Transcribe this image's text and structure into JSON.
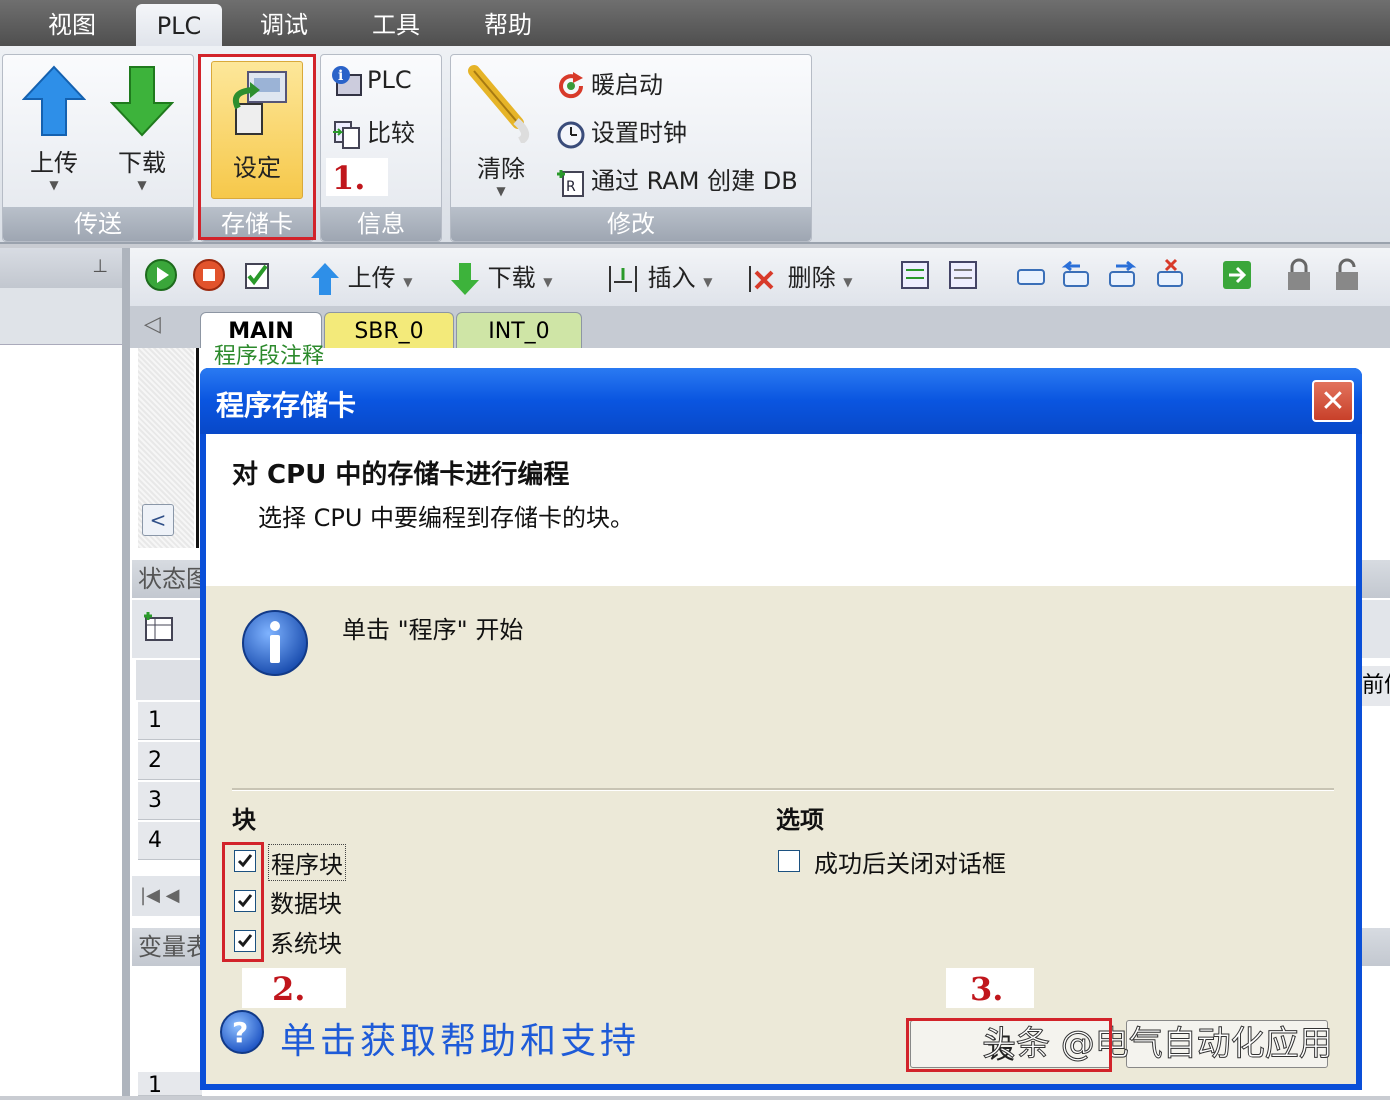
{
  "menu": [
    "视图",
    "PLC",
    "调试",
    "工具",
    "帮助"
  ],
  "ribbon": {
    "transfer": {
      "upload": "上传",
      "download": "下载",
      "group": "传送"
    },
    "memory_card": {
      "setup": "设定",
      "group": "存储卡"
    },
    "info": {
      "plc": "PLC",
      "compare": "比较",
      "group": "信息"
    },
    "modify": {
      "clear": "清除",
      "warm_start": "暖启动",
      "set_clock": "设置时钟",
      "create_db": "通过 RAM 创建 DB",
      "group": "修改"
    }
  },
  "editor_toolbar": {
    "upload": "上传",
    "download": "下载",
    "insert": "插入",
    "delete": "删除"
  },
  "tabs": [
    "MAIN",
    "SBR_0",
    "INT_0"
  ],
  "code_comment": "程序段注释",
  "status_panel": {
    "title": "状态图",
    "rows": [
      "1",
      "2",
      "3",
      "4"
    ],
    "col_partial": "前值"
  },
  "var_panel": {
    "title": "变量表",
    "rows": [
      "1"
    ]
  },
  "dialog": {
    "title": "程序存储卡",
    "heading": "对 CPU 中的存储卡进行编程",
    "subheading": "选择 CPU 中要编程到存储卡的块。",
    "info_text": "单击 \"程序\" 开始",
    "blocks_label": "块",
    "blocks": [
      {
        "label": "程序块",
        "checked": true
      },
      {
        "label": "数据块",
        "checked": true
      },
      {
        "label": "系统块",
        "checked": true
      }
    ],
    "options_label": "选项",
    "option_close": {
      "label": "成功后关闭对话框",
      "checked": false
    },
    "help_link": "单击获取帮助和支持",
    "watermark": "头条 @电气自动化应用",
    "button_partial": "设"
  },
  "annotations": {
    "step1": "1.",
    "step2": "2.",
    "step3": "3."
  },
  "colors": {
    "accent_red": "#d2232a",
    "title_blue": "#0a55e0",
    "help_blue": "#1e5bd8"
  }
}
